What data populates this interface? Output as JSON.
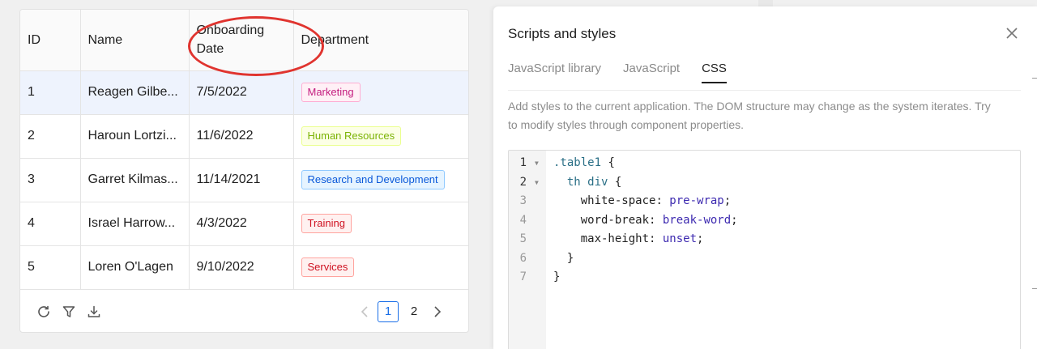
{
  "table": {
    "headers": [
      "ID",
      "Name",
      "Onboarding\nDate",
      "Department"
    ],
    "rows": [
      {
        "id": "1",
        "name": "Reagen Gilbe...",
        "date": "7/5/2022",
        "dept": "Marketing"
      },
      {
        "id": "2",
        "name": "Haroun Lortzi...",
        "date": "11/6/2022",
        "dept": "Human Resources"
      },
      {
        "id": "3",
        "name": "Garret Kilmas...",
        "date": "11/14/2021",
        "dept": "Research and Development"
      },
      {
        "id": "4",
        "name": "Israel Harrow...",
        "date": "4/3/2022",
        "dept": "Training"
      },
      {
        "id": "5",
        "name": "Loren O'Lagen",
        "date": "9/10/2022",
        "dept": "Services"
      }
    ],
    "tag_colors": {
      "Marketing": {
        "fg": "#c41d7f",
        "bg": "#fff0f6",
        "border": "#ffadd2"
      },
      "Human Resources": {
        "fg": "#7cb305",
        "bg": "#fcffe6",
        "border": "#eaff8f"
      },
      "Research and Development": {
        "fg": "#0958d9",
        "bg": "#e6f4ff",
        "border": "#91caff"
      },
      "Training": {
        "fg": "#cf1322",
        "bg": "#fff1f0",
        "border": "#ffa39e"
      },
      "Services": {
        "fg": "#cf1322",
        "bg": "#fff1f0",
        "border": "#ffa39e"
      }
    },
    "selected_row": 0,
    "icons": [
      "refresh-icon",
      "filter-icon",
      "download-icon"
    ],
    "pagination": {
      "pages": [
        "1",
        "2"
      ],
      "current": "1"
    }
  },
  "panel": {
    "title": "Scripts and styles",
    "tabs": [
      {
        "label": "JavaScript library",
        "active": false
      },
      {
        "label": "JavaScript",
        "active": false
      },
      {
        "label": "CSS",
        "active": true
      }
    ],
    "description": "Add styles to the current application. The DOM structure may change as the system iterates. Try to modify styles through component properties.",
    "code_lines": [
      {
        "num": "1",
        "fold": true,
        "tokens": [
          {
            "t": ".table1",
            "c": "sel"
          },
          {
            "t": " {",
            "c": ""
          }
        ]
      },
      {
        "num": "2",
        "fold": true,
        "tokens": [
          {
            "t": "  th div",
            "c": "sel"
          },
          {
            "t": " {",
            "c": ""
          }
        ]
      },
      {
        "num": "3",
        "fold": false,
        "tokens": [
          {
            "t": "    white-space",
            "c": ""
          },
          {
            "t": ": ",
            "c": ""
          },
          {
            "t": "pre-wrap",
            "c": "val"
          },
          {
            "t": ";",
            "c": ""
          }
        ]
      },
      {
        "num": "4",
        "fold": false,
        "tokens": [
          {
            "t": "    word-break",
            "c": ""
          },
          {
            "t": ": ",
            "c": ""
          },
          {
            "t": "break-word",
            "c": "val"
          },
          {
            "t": ";",
            "c": ""
          }
        ]
      },
      {
        "num": "5",
        "fold": false,
        "tokens": [
          {
            "t": "    max-height",
            "c": ""
          },
          {
            "t": ": ",
            "c": ""
          },
          {
            "t": "unset",
            "c": "val"
          },
          {
            "t": ";",
            "c": ""
          }
        ]
      },
      {
        "num": "6",
        "fold": false,
        "tokens": [
          {
            "t": "  }",
            "c": ""
          }
        ]
      },
      {
        "num": "7",
        "fold": false,
        "tokens": [
          {
            "t": "}",
            "c": ""
          }
        ]
      }
    ]
  },
  "colors": {
    "accent": "#1a6fe8",
    "highlight": "#e0342f"
  }
}
